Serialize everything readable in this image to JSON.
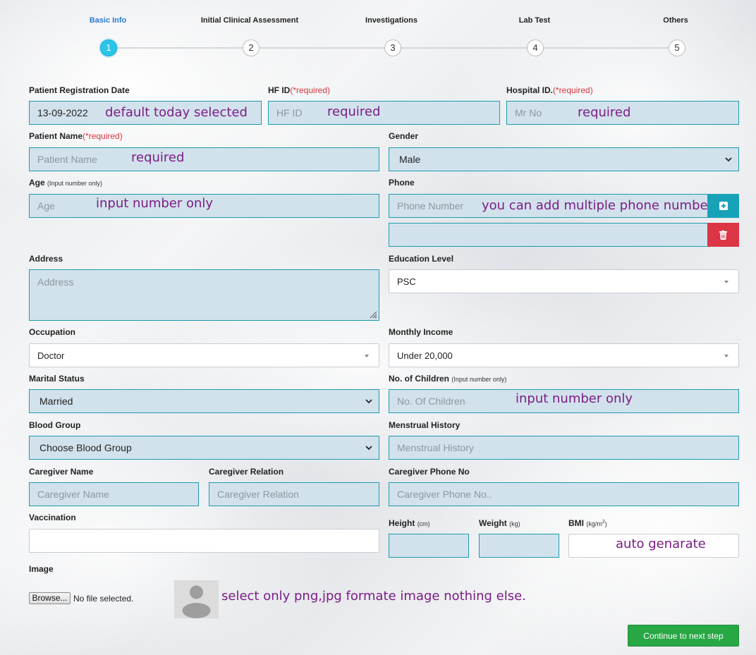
{
  "stepper": {
    "steps": [
      {
        "label": "Basic Info",
        "number": "1"
      },
      {
        "label": "Initial Clinical Assessment",
        "number": "2"
      },
      {
        "label": "Investigations",
        "number": "3"
      },
      {
        "label": "Lab Test",
        "number": "4"
      },
      {
        "label": "Others",
        "number": "5"
      }
    ],
    "active_step": 1
  },
  "required_marker": "(*required)",
  "input_number_only_hint": "(Input number only)",
  "fields": {
    "registration_date": {
      "label": "Patient Registration Date",
      "value": "13-09-2022"
    },
    "hf_id": {
      "label": "HF ID",
      "placeholder": "HF ID"
    },
    "hospital_id": {
      "label": "Hospital ID.",
      "placeholder": "Mr No"
    },
    "patient_name": {
      "label": "Patient Name",
      "placeholder": "Patient Name"
    },
    "gender": {
      "label": "Gender",
      "value": "Male"
    },
    "age": {
      "label": "Age",
      "placeholder": "Age"
    },
    "phone": {
      "label": "Phone",
      "placeholder": "Phone Number",
      "second_value": ""
    },
    "address": {
      "label": "Address",
      "placeholder": "Address"
    },
    "education_level": {
      "label": "Education Level",
      "value": "PSC"
    },
    "occupation": {
      "label": "Occupation",
      "value": "Doctor"
    },
    "monthly_income": {
      "label": "Monthly Income",
      "value": "Under 20,000"
    },
    "marital_status": {
      "label": "Marital Status",
      "value": "Married"
    },
    "no_of_children": {
      "label": "No. of Children",
      "placeholder": "No. Of Children"
    },
    "blood_group": {
      "label": "Blood Group",
      "value": "Choose Blood Group"
    },
    "menstrual_history": {
      "label": "Menstrual History",
      "placeholder": "Menstrual History"
    },
    "caregiver_name": {
      "label": "Caregiver Name",
      "placeholder": "Caregiver Name"
    },
    "caregiver_relation": {
      "label": "Caregiver Relation",
      "placeholder": "Caregiver Relation"
    },
    "caregiver_phone": {
      "label": "Caregiver Phone No",
      "placeholder": "Caregiver Phone No.."
    },
    "vaccination": {
      "label": "Vaccination",
      "value": ""
    },
    "height": {
      "label": "Height",
      "unit": "(cm)",
      "value": ""
    },
    "weight": {
      "label": "Weight",
      "unit": "(kg)",
      "value": ""
    },
    "bmi": {
      "label": "BMI",
      "unit_base": "(kg/m",
      "unit_sup": "2",
      "unit_close": ")",
      "value": ""
    },
    "image": {
      "label": "Image",
      "browse_label": "Browse...",
      "no_file_text": "No file selected."
    }
  },
  "notes": {
    "registration_date": "default today selected",
    "hf_id": "required",
    "hospital_id": "required",
    "patient_name": "required",
    "age": "input number only",
    "phone": "you can add multiple phone number",
    "no_of_children": "input number only",
    "bmi": "auto genarate",
    "image": "select only png,jpg formate image nothing else."
  },
  "actions": {
    "continue_label": "Continue to next step"
  },
  "icons": {
    "add_phone": "plus-square-icon",
    "remove_phone": "trash-icon",
    "select_chevron": "chevron-down-icon",
    "avatar": "user-silhouette-icon"
  },
  "colors": {
    "input_background": "#d2e2ec",
    "input_border": "#1e9bb0",
    "active_step": "#29c5ea",
    "required": "#d9363e",
    "note": "#7b1d86",
    "add_button": "#17a2b8",
    "delete_button": "#dc3545",
    "continue_button": "#28a745"
  }
}
